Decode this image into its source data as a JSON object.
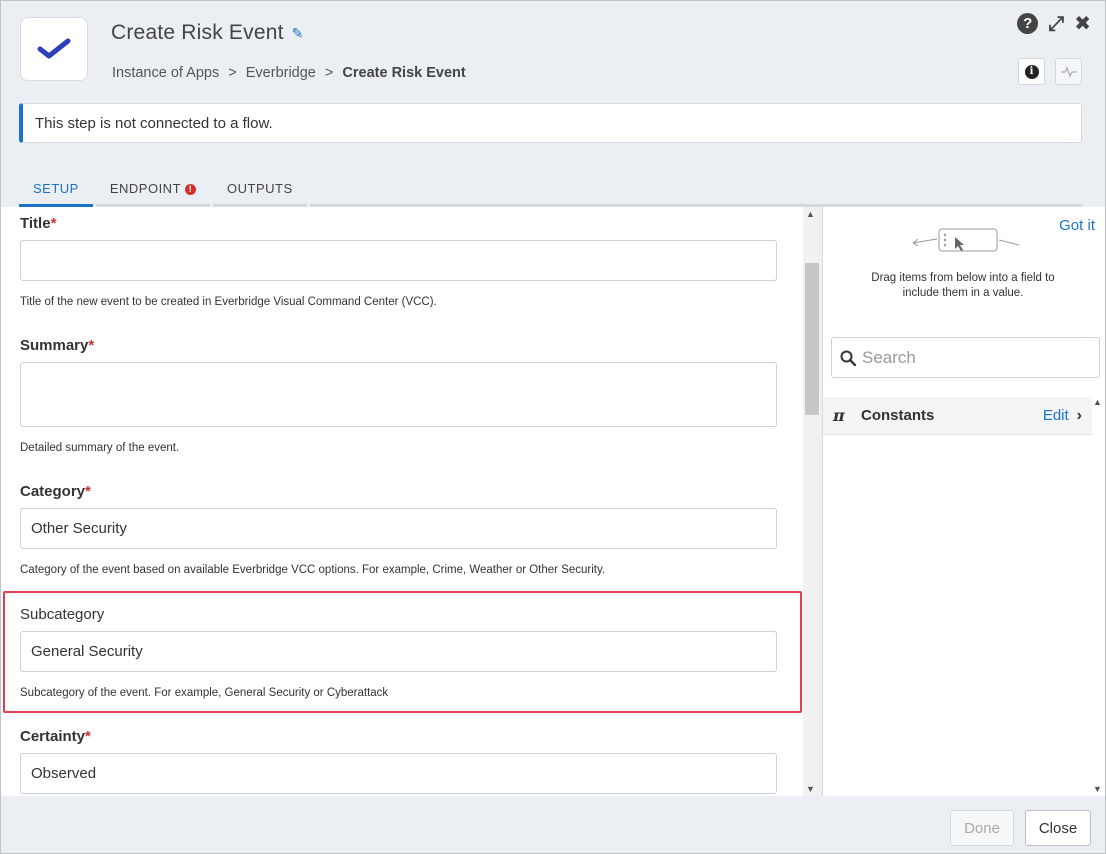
{
  "header": {
    "title": "Create Risk Event",
    "breadcrumb": {
      "part1": "Instance of Apps",
      "sep": ">",
      "part2": "Everbridge",
      "current": "Create Risk Event"
    }
  },
  "notice": "This step is not connected to a flow.",
  "tabs": [
    {
      "label": "SETUP",
      "active": true
    },
    {
      "label": "ENDPOINT",
      "error": true
    },
    {
      "label": "OUTPUTS"
    }
  ],
  "form": {
    "title": {
      "label": "Title",
      "required": "*",
      "value": "",
      "hint": "Title of the new event to be created in Everbridge Visual Command Center (VCC)."
    },
    "summary": {
      "label": "Summary",
      "required": "*",
      "value": "",
      "hint": "Detailed summary of the event."
    },
    "category": {
      "label": "Category",
      "required": "*",
      "value": "Other Security",
      "hint": "Category of the event based on available Everbridge VCC options. For example, Crime, Weather or Other Security."
    },
    "subcategory": {
      "label": "Subcategory",
      "value": "General Security",
      "hint": "Subcategory of the event. For example, General Security or Cyberattack"
    },
    "certainty": {
      "label": "Certainty",
      "required": "*",
      "value": "Observed"
    }
  },
  "sidebar": {
    "got_it": "Got it",
    "drag_hint": "Drag items from below into a field to include them in a value.",
    "search_placeholder": "Search",
    "constants_label": "Constants",
    "edit_label": "Edit"
  },
  "footer": {
    "done_label": "Done",
    "close_label": "Close"
  },
  "colors": {
    "accent": "#1a73c8",
    "required": "#d32f2f",
    "highlight": "#e0404a"
  }
}
